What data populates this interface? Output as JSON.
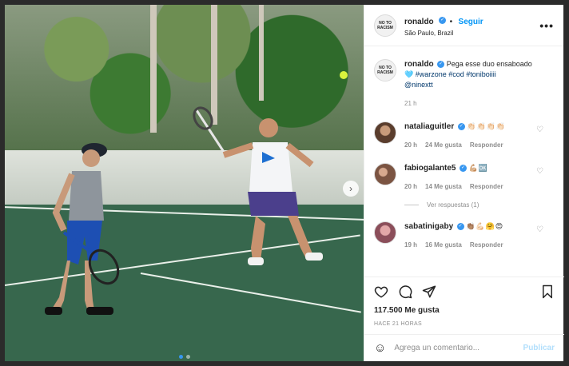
{
  "post": {
    "username": "ronaldo",
    "follow_label": "Seguir",
    "separator": "•",
    "location": "São Paulo, Brazil",
    "more_label": "•••",
    "avatar_text": "NO TO\nRACISM"
  },
  "caption": {
    "username": "ronaldo",
    "text": "Pega esse duo ensaboado",
    "line2": "🩵 #warzone #cod #toniboiiii",
    "line3": "@ninextt",
    "time": "21 h"
  },
  "comments": [
    {
      "username": "nataliaguitler",
      "text": "👏🏻👏🏻👏🏻👏🏻",
      "time": "20 h",
      "likes": "24 Me gusta",
      "reply": "Responder"
    },
    {
      "username": "fabiogalante5",
      "text": "💪🏼🆗",
      "time": "20 h",
      "likes": "14 Me gusta",
      "reply": "Responder",
      "view_replies": "Ver respuestas (1)"
    },
    {
      "username": "sabatinigaby",
      "text": "👏🏽💪🏻🤗😍",
      "time": "19 h",
      "likes": "16 Me gusta",
      "reply": "Responder"
    }
  ],
  "stats": {
    "likes": "117.500 Me gusta",
    "ago": "HACE 21 HORAS"
  },
  "composer": {
    "placeholder": "Agrega un comentario...",
    "post_label": "Publicar"
  },
  "colors": {
    "accent": "#0095f6",
    "verified": "#3897f0",
    "muted": "#8e8e8e"
  }
}
